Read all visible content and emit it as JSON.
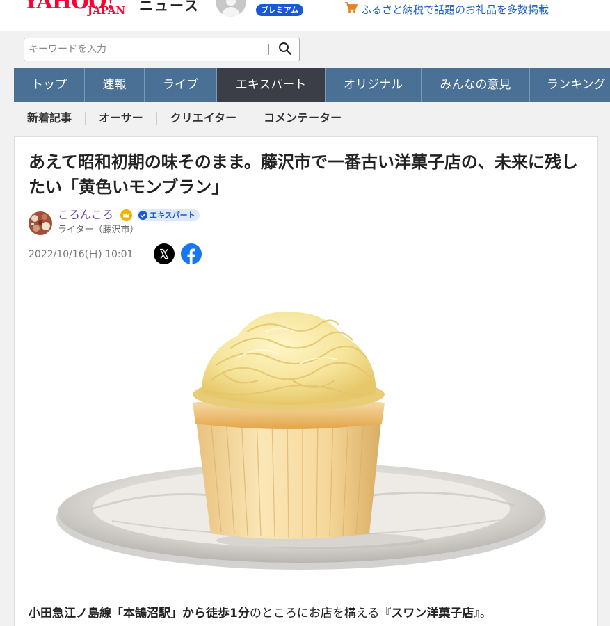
{
  "header": {
    "logo_yahoo": "YAHOO!",
    "logo_japan": "JAPAN",
    "section": "ニュース",
    "premium_badge": "プレミアム",
    "promo_text": "ふるさと納税で話題のお礼品を多数掲載",
    "promo_icon": "cart-icon"
  },
  "search": {
    "placeholder": "キーワードを入力"
  },
  "nav": {
    "tabs": [
      {
        "label": "トップ",
        "active": false
      },
      {
        "label": "速報",
        "active": false
      },
      {
        "label": "ライブ",
        "active": false
      },
      {
        "label": "エキスパート",
        "active": true
      },
      {
        "label": "オリジナル",
        "active": false
      },
      {
        "label": "みんなの意見",
        "active": false
      },
      {
        "label": "ランキング",
        "active": false
      }
    ]
  },
  "subnav": {
    "items": [
      "新着記事",
      "オーサー",
      "クリエイター",
      "コメンテーター"
    ]
  },
  "article": {
    "title": "あえて昭和初期の味そのまま。藤沢市で一番古い洋菓子店の、未来に残したい「黄色いモンブラン」",
    "author_name": "ころんころ",
    "expert_badge": "エキスパート",
    "author_role": "ライター（藤沢市）",
    "date": "2022/10/16(日) 10:01",
    "lead": {
      "b1": "小田急江ノ島線「本鵠沼駅」から徒歩1分",
      "t1": "のところにお店を構える『",
      "b2": "スワン洋菓子店",
      "t2": "』。"
    }
  },
  "colors": {
    "brand_red": "#ff0033",
    "nav_bg": "#4a7096",
    "nav_active": "#3b3d47",
    "premium_blue": "#1a57d6",
    "author_purple": "#6a3fa0"
  }
}
